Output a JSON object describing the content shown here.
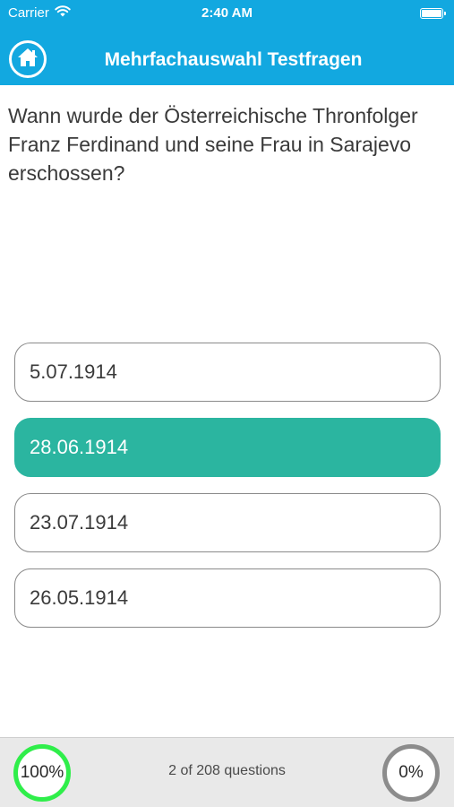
{
  "status_bar": {
    "carrier": "Carrier",
    "time": "2:40 AM",
    "wifi_icon": "wifi-icon",
    "battery_icon": "battery-icon"
  },
  "nav": {
    "title": "Mehrfachauswahl Testfragen",
    "home_icon": "home-icon"
  },
  "question": {
    "text": "Wann wurde der Österreichische Thronfolger Franz Ferdinand und seine Frau in Sarajevo erschossen?"
  },
  "answers": [
    {
      "label": "5.07.1914",
      "selected": false
    },
    {
      "label": "28.06.1914",
      "selected": true
    },
    {
      "label": "23.07.1914",
      "selected": false
    },
    {
      "label": "26.05.1914",
      "selected": false
    }
  ],
  "footer": {
    "correct_percent": "100%",
    "wrong_percent": "0%",
    "progress_text": "2 of 208 questions"
  },
  "colors": {
    "header": "#12a8e0",
    "selected_answer": "#2bb5a0",
    "correct_ring": "#2fee4a",
    "wrong_ring": "#8c8c8c"
  }
}
